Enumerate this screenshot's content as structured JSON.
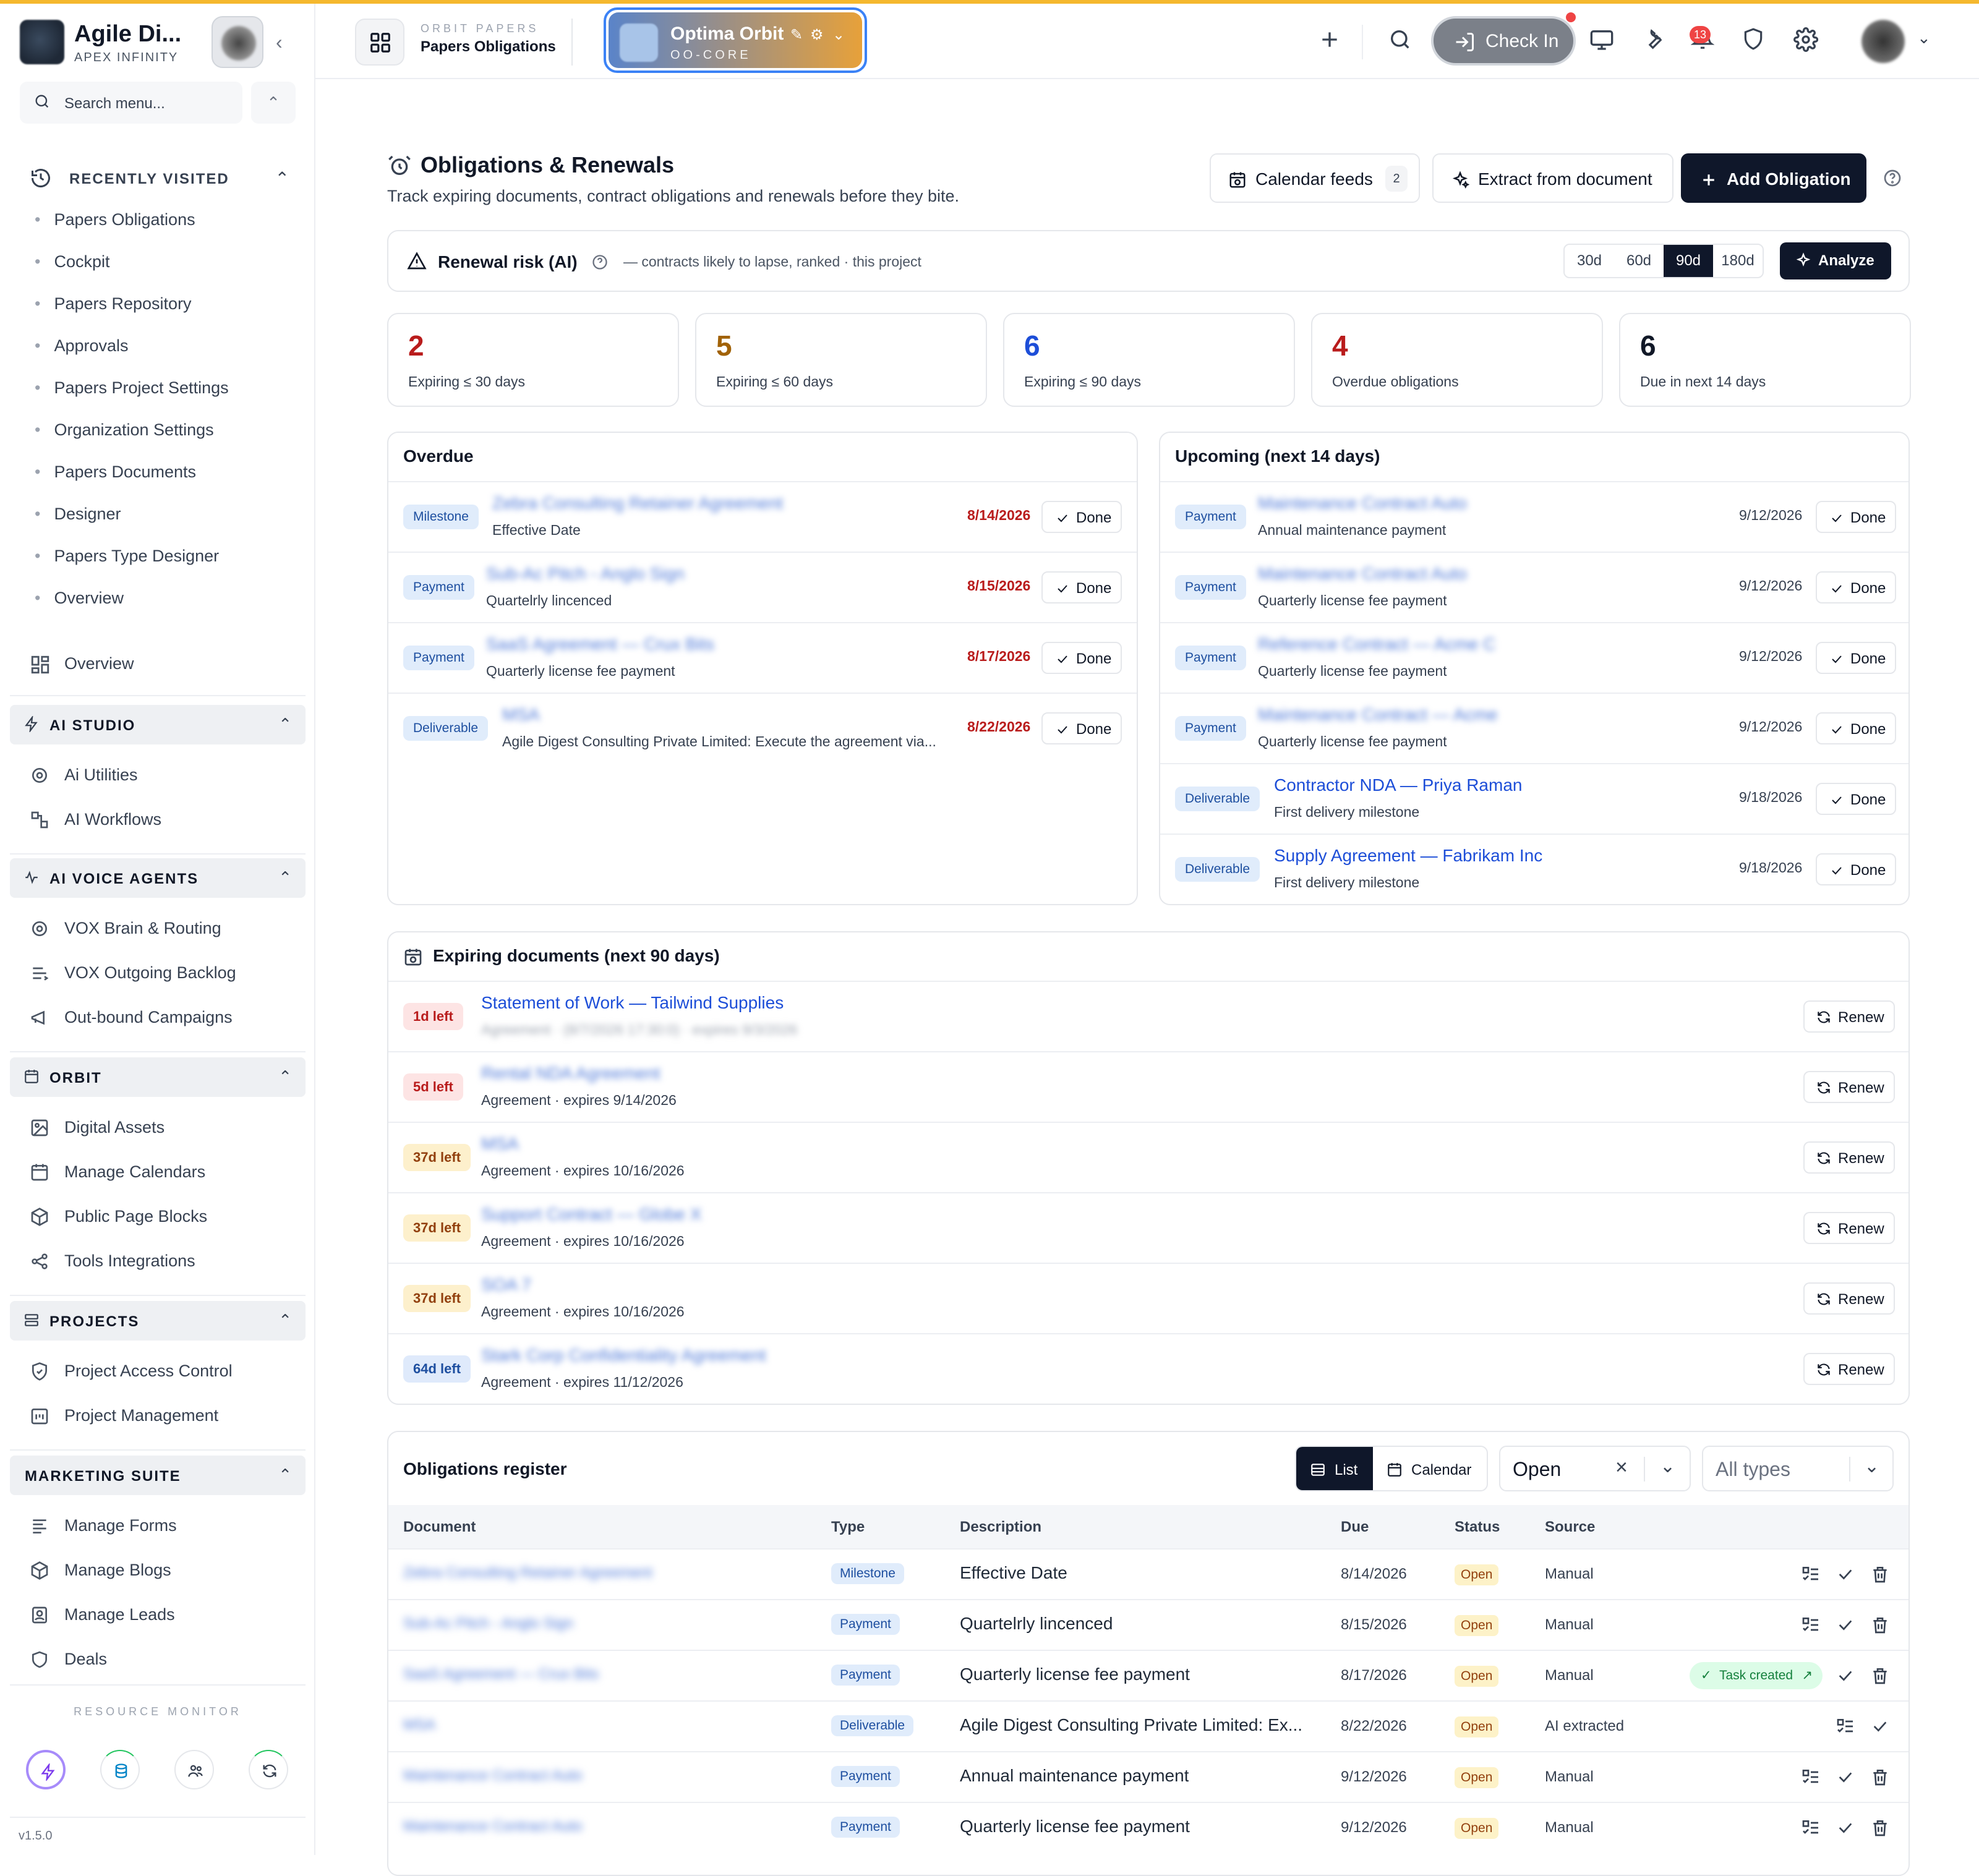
{
  "sidebar": {
    "brand_name": "Agile Di...",
    "brand_sub": "APEX INFINITY",
    "search_placeholder": "Search menu...",
    "recent_label": "RECENTLY VISITED",
    "recent": [
      "Papers Obligations",
      "Cockpit",
      "Papers Repository",
      "Approvals",
      "Papers Project Settings",
      "Organization Settings",
      "Papers Documents",
      "Designer",
      "Papers Type Designer",
      "Overview"
    ],
    "overview_label": "Overview",
    "sections": [
      {
        "title": "AI STUDIO",
        "items": [
          "Ai Utilities",
          "AI Workflows"
        ]
      },
      {
        "title": "AI VOICE AGENTS",
        "items": [
          "VOX Brain & Routing",
          "VOX Outgoing Backlog",
          "Out-bound Campaigns"
        ]
      },
      {
        "title": "ORBIT",
        "items": [
          "Digital Assets",
          "Manage Calendars",
          "Public Page Blocks",
          "Tools Integrations"
        ]
      },
      {
        "title": "PROJECTS",
        "items": [
          "Project Access Control",
          "Project Management"
        ]
      },
      {
        "title": "MARKETING SUITE",
        "items": [
          "Manage Forms",
          "Manage Blogs",
          "Manage Leads",
          "Deals"
        ]
      }
    ],
    "resource_monitor": "RESOURCE MONITOR",
    "version": "v1.5.0"
  },
  "header": {
    "crumb_sub": "ORBIT PAPERS",
    "crumb_main": "Papers Obligations",
    "orbit_name": "Optima Orbit",
    "orbit_code": "OO-CORE",
    "checkin": "Check In",
    "notifications": "13"
  },
  "page": {
    "title": "Obligations & Renewals",
    "subtitle": "Track expiring documents, contract obligations and renewals before they bite.",
    "calendar_feeds": "Calendar feeds",
    "calendar_feeds_count": "2",
    "extract": "Extract from document",
    "add": "Add Obligation"
  },
  "risk": {
    "title": "Renewal risk (AI)",
    "sub": "— contracts likely to lapse, ranked · this project",
    "ranges": [
      "30d",
      "60d",
      "90d",
      "180d"
    ],
    "active_range": "90d",
    "analyze": "Analyze"
  },
  "stats": [
    {
      "value": "2",
      "label": "Expiring ≤ 30 days",
      "color": "#b91c1c"
    },
    {
      "value": "5",
      "label": "Expiring ≤ 60 days",
      "color": "#a16207"
    },
    {
      "value": "6",
      "label": "Expiring ≤ 90 days",
      "color": "#1d4ed8"
    },
    {
      "value": "4",
      "label": "Overdue obligations",
      "color": "#b91c1c"
    },
    {
      "value": "6",
      "label": "Due in next 14 days",
      "color": "#111827"
    }
  ],
  "overdue": {
    "title": "Overdue",
    "done": "Done",
    "rows": [
      {
        "tag": "Milestone",
        "title": "Zebra Consulting Retainer Agreement",
        "desc": "Effective Date",
        "date": "8/14/2026"
      },
      {
        "tag": "Payment",
        "title": "Sub-Ac Pitch - Anglo Sign",
        "desc": "Quartelrly lincenced",
        "date": "8/15/2026"
      },
      {
        "tag": "Payment",
        "title": "SaaS Agreement — Crux Bits",
        "desc": "Quarterly license fee payment",
        "date": "8/17/2026"
      },
      {
        "tag": "Deliverable",
        "title": "MSA",
        "desc": "Agile Digest Consulting Private Limited: Execute the agreement via...",
        "date": "8/22/2026"
      }
    ]
  },
  "upcoming": {
    "title": "Upcoming (next 14 days)",
    "done": "Done",
    "rows": [
      {
        "tag": "Payment",
        "title": "Maintenance Contract Auto",
        "desc": "Annual maintenance payment",
        "date": "9/12/2026",
        "blur": true
      },
      {
        "tag": "Payment",
        "title": "Maintenance Contract Auto",
        "desc": "Quarterly license fee payment",
        "date": "9/12/2026",
        "blur": true
      },
      {
        "tag": "Payment",
        "title": "Reference Contract — Acme C",
        "desc": "Quarterly license fee payment",
        "date": "9/12/2026",
        "blur": true
      },
      {
        "tag": "Payment",
        "title": "Maintenance Contract — Acme",
        "desc": "Quarterly license fee payment",
        "date": "9/12/2026",
        "blur": true
      },
      {
        "tag": "Deliverable",
        "title": "Contractor NDA — Priya Raman",
        "desc": "First delivery milestone",
        "date": "9/18/2026",
        "blur": false
      },
      {
        "tag": "Deliverable",
        "title": "Supply Agreement — Fabrikam Inc",
        "desc": "First delivery milestone",
        "date": "9/18/2026",
        "blur": false
      }
    ]
  },
  "expiring": {
    "title": "Expiring documents (next 90 days)",
    "renew": "Renew",
    "rows": [
      {
        "left": "1d left",
        "title": "Statement of Work — Tailwind Supplies",
        "desc": "Agreement · (8/7/2026 17:30:0) · expires 9/3/2026",
        "blur_title": false,
        "blur_desc": true,
        "tone": "red"
      },
      {
        "left": "5d left",
        "title": "Rental NDA Agreement",
        "desc": "Agreement · expires 9/14/2026",
        "blur_title": true,
        "blur_desc": false,
        "tone": "red"
      },
      {
        "left": "37d left",
        "title": "MSA",
        "desc": "Agreement · expires 10/16/2026",
        "blur_title": true,
        "blur_desc": false,
        "tone": "amber"
      },
      {
        "left": "37d left",
        "title": "Support Contract — Globe X",
        "desc": "Agreement · expires 10/16/2026",
        "blur_title": true,
        "blur_desc": false,
        "tone": "amber"
      },
      {
        "left": "37d left",
        "title": "SOA 7",
        "desc": "Agreement · expires 10/16/2026",
        "blur_title": true,
        "blur_desc": false,
        "tone": "amber"
      },
      {
        "left": "64d left",
        "title": "Stark Corp Confidentiality Agreement",
        "desc": "Agreement · expires 11/12/2026",
        "blur_title": true,
        "blur_desc": false,
        "tone": "blue"
      }
    ]
  },
  "register": {
    "title": "Obligations register",
    "view_list": "List",
    "view_calendar": "Calendar",
    "status_filter": "Open",
    "type_filter": "All types",
    "columns": [
      "Document",
      "Type",
      "Description",
      "Due",
      "Status",
      "Source"
    ],
    "task_created": "Task created",
    "rows": [
      {
        "doc": "Zebra Consulting Retainer Agreement",
        "type": "Milestone",
        "desc": "Effective Date",
        "due": "8/14/2026",
        "status": "Open",
        "source": "Manual",
        "task": false,
        "del": true
      },
      {
        "doc": "Sub-Ac Pitch - Anglo Sign",
        "type": "Payment",
        "desc": "Quartelrly lincenced",
        "due": "8/15/2026",
        "status": "Open",
        "source": "Manual",
        "task": false,
        "del": true
      },
      {
        "doc": "SaaS Agreement — Crux Bits",
        "type": "Payment",
        "desc": "Quarterly license fee payment",
        "due": "8/17/2026",
        "status": "Open",
        "source": "Manual",
        "task": true,
        "del": true
      },
      {
        "doc": "MSA",
        "type": "Deliverable",
        "desc": "Agile Digest Consulting Private Limited: Ex...",
        "due": "8/22/2026",
        "status": "Open",
        "source": "AI extracted",
        "task": false,
        "del": false
      },
      {
        "doc": "Maintenance Contract Auto",
        "type": "Payment",
        "desc": "Annual maintenance payment",
        "due": "9/12/2026",
        "status": "Open",
        "source": "Manual",
        "task": false,
        "del": true
      },
      {
        "doc": "Maintenance Contract Auto",
        "type": "Payment",
        "desc": "Quarterly license fee payment",
        "due": "9/12/2026",
        "status": "Open",
        "source": "Manual",
        "task": false,
        "del": true
      }
    ]
  }
}
